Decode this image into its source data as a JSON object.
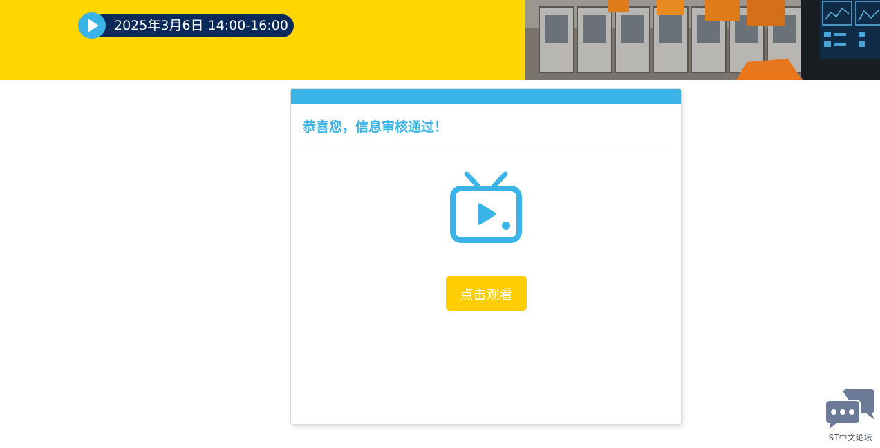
{
  "banner": {
    "date_text": "2025年3月6日  14:00-16:00",
    "play_icon": "play-icon",
    "colors": {
      "background": "#ffd600",
      "pill": "#0b2a5a",
      "play": "#39b3e6"
    }
  },
  "card": {
    "title": "恭喜您，信息审核通过！",
    "icon": "tv-icon",
    "watch_button_label": "点击观看",
    "colors": {
      "accent": "#3ab4e6",
      "button": "#ffcc00"
    }
  },
  "forum": {
    "label": "ST中文论坛",
    "icon": "chat-bubbles-icon",
    "color": "#6b7a96"
  }
}
